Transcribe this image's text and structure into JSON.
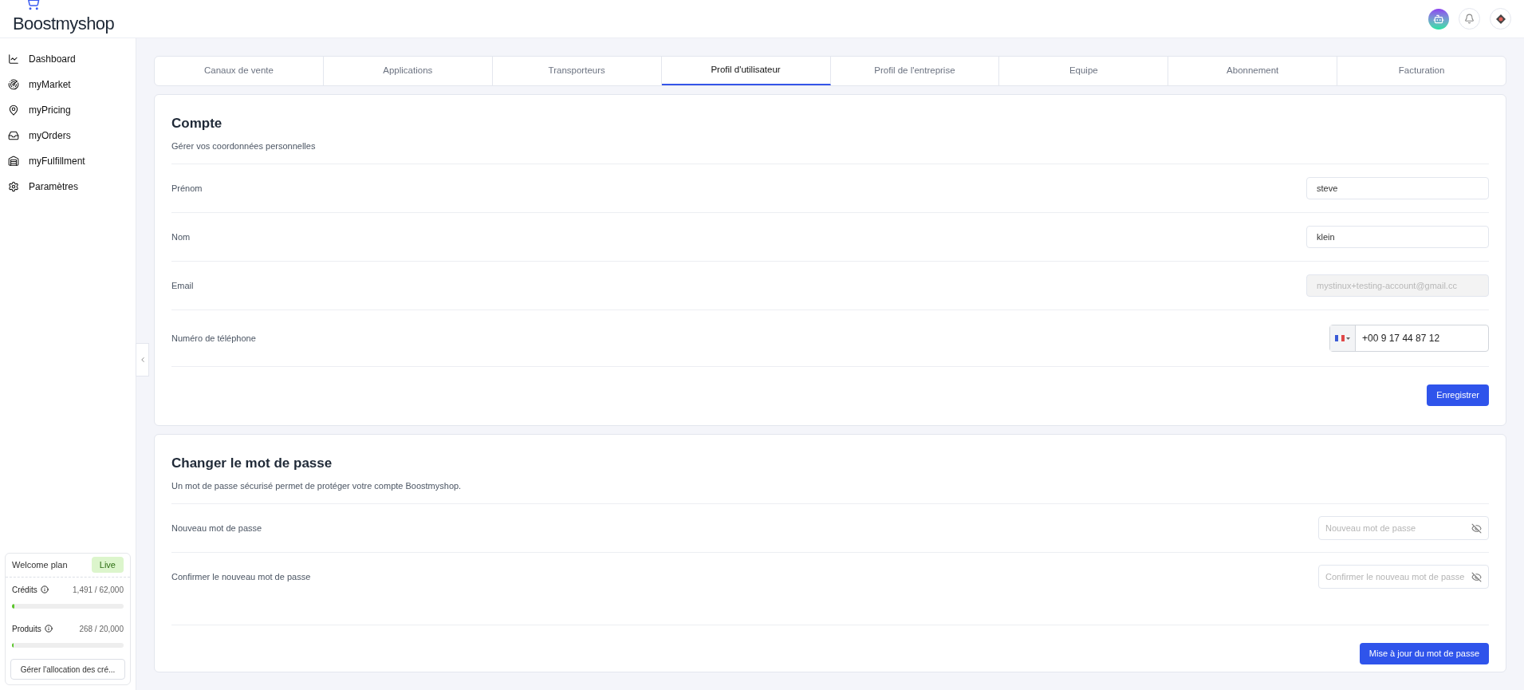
{
  "header": {
    "logo": "Boostmyshop"
  },
  "sidebar": {
    "items": [
      {
        "label": "Dashboard",
        "kind": "chart",
        "selected": false
      },
      {
        "label": "myMarket",
        "kind": "market",
        "selected": false
      },
      {
        "label": "myPricing",
        "kind": "pricing",
        "selected": false
      },
      {
        "label": "myOrders",
        "kind": "orders",
        "selected": false
      },
      {
        "label": "myFulfillment",
        "kind": "warehouse",
        "selected": false
      },
      {
        "label": "Paramètres",
        "kind": "settings",
        "selected": false
      }
    ],
    "plan": {
      "name": "Welcome plan",
      "badge": "Live",
      "meters": [
        {
          "label": "Crédits",
          "reading": "1,491 / 62,000",
          "level": 0.024
        },
        {
          "label": "Produits",
          "reading": "268 / 20,000",
          "level": 0.013
        }
      ],
      "button": "Gérer l'allocation des cré..."
    }
  },
  "tabs": [
    {
      "label": "Canaux de vente",
      "selected": false
    },
    {
      "label": "Applications",
      "selected": false
    },
    {
      "label": "Transporteurs",
      "selected": false
    },
    {
      "label": "Profil d'utilisateur",
      "selected": true
    },
    {
      "label": "Profil de l'entreprise",
      "selected": false
    },
    {
      "label": "Equipe",
      "selected": false
    },
    {
      "label": "Abonnement",
      "selected": false
    },
    {
      "label": "Facturation",
      "selected": false
    }
  ],
  "sections": [
    {
      "title": "Compte",
      "subtitle": "Gérer vos coordonnées personnelles",
      "fields": [
        {
          "label": "Prénom",
          "kind": "text",
          "value": "steve",
          "disabled": false
        },
        {
          "label": "Nom",
          "kind": "text",
          "value": "klein",
          "disabled": false
        },
        {
          "label": "Email",
          "kind": "text",
          "value": "mystinux+testing-account@gmail.cc",
          "disabled": true
        },
        {
          "label": "Numéro de téléphone",
          "kind": "phone",
          "value": "+00 9 17 44 87 12"
        }
      ],
      "button": "Enregistrer"
    },
    {
      "title": "Changer le mot de passe",
      "subtitle": "Un mot de passe sécurisé permet de protéger votre compte Boostmyshop.",
      "fields": [
        {
          "label": "Nouveau mot de passe",
          "kind": "password",
          "placeholder": "Nouveau mot de passe",
          "disabled": false
        },
        {
          "label": "Confirmer le nouveau mot de passe",
          "kind": "password",
          "placeholder": "Confirmer le nouveau mot de passe",
          "disabled": false
        }
      ],
      "button": "Mise à jour du mot de passe"
    }
  ]
}
